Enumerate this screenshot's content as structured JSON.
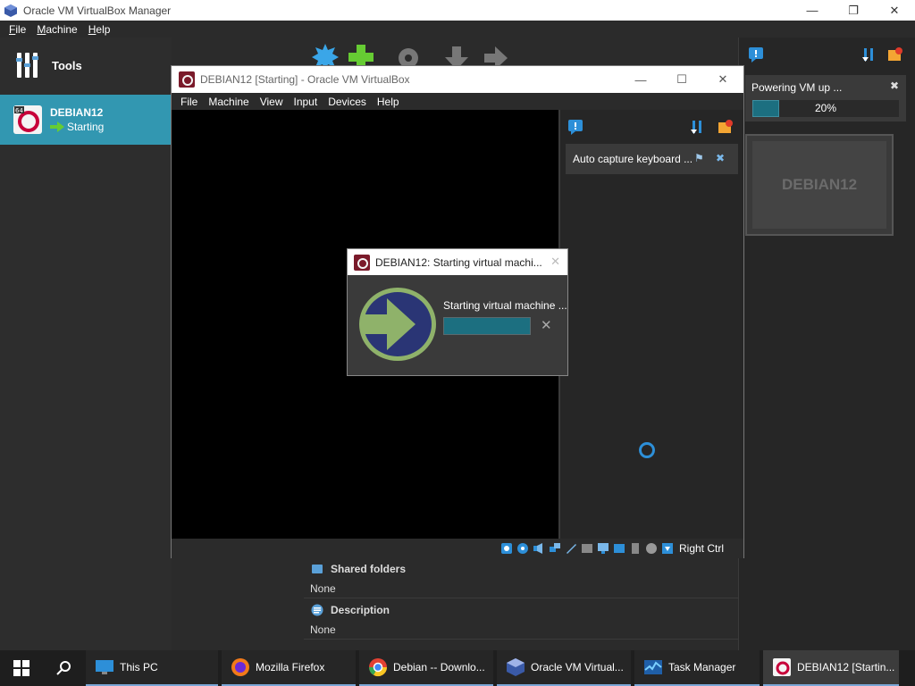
{
  "manager": {
    "title": "Oracle VM VirtualBox Manager",
    "menu": [
      "File",
      "Machine",
      "Help"
    ],
    "tools_label": "Tools",
    "vm": {
      "name": "DEBIAN12",
      "state": "Starting"
    },
    "notification": {
      "message": "Powering VM up ...",
      "progress_percent": 20,
      "progress_text": "20%"
    },
    "preview_name": "DEBIAN12",
    "details": [
      {
        "title": "Shared folders",
        "value": "None"
      },
      {
        "title": "Description",
        "value": "None"
      }
    ]
  },
  "vm_window": {
    "title": "DEBIAN12 [Starting] - Oracle VM VirtualBox",
    "menu": [
      "File",
      "Machine",
      "View",
      "Input",
      "Devices",
      "Help"
    ],
    "notification": "Auto capture keyboard ...",
    "host_key": "Right Ctrl"
  },
  "dialog": {
    "title": "DEBIAN12: Starting virtual machi...",
    "message": "Starting virtual machine ...",
    "progress_percent": 100
  },
  "taskbar": {
    "items": [
      {
        "label": "This PC",
        "icon": "monitor-icon"
      },
      {
        "label": "Mozilla Firefox",
        "icon": "firefox-icon"
      },
      {
        "label": "Debian -- Downlo...",
        "icon": "chrome-icon"
      },
      {
        "label": "Oracle VM Virtual...",
        "icon": "virtualbox-icon"
      },
      {
        "label": "Task Manager",
        "icon": "task-manager-icon"
      },
      {
        "label": "DEBIAN12 [Startin...",
        "icon": "debian-icon"
      }
    ]
  },
  "colors": {
    "accent": "#3297b1",
    "progress": "#1c6f80",
    "arrow_green": "#66cc33"
  }
}
